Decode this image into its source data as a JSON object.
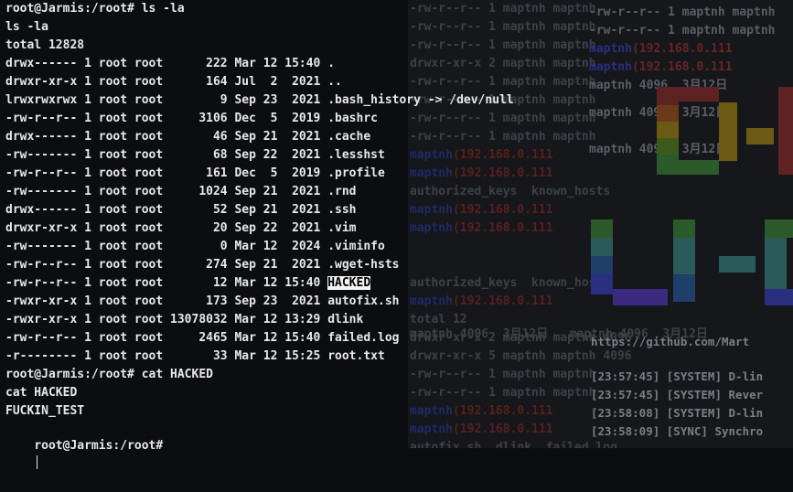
{
  "foreground_terminal": {
    "lines": [
      "root@Jarmis:/root# ls -la",
      "ls -la",
      "total 12828",
      "drwx------ 1 root root      222 Mar 12 15:40 .",
      "drwxr-xr-x 1 root root      164 Jul  2  2021 ..",
      "lrwxrwxrwx 1 root root        9 Sep 23  2021 .bash_history -> /dev/null",
      "-rw-r--r-- 1 root root     3106 Dec  5  2019 .bashrc",
      "drwx------ 1 root root       46 Sep 21  2021 .cache",
      "-rw------- 1 root root       68 Sep 22  2021 .lesshst",
      "-rw-r--r-- 1 root root      161 Dec  5  2019 .profile",
      "-rw------- 1 root root     1024 Sep 21  2021 .rnd",
      "drwx------ 1 root root       52 Sep 21  2021 .ssh",
      "drwxr-xr-x 1 root root       20 Sep 22  2021 .vim",
      "-rw------- 1 root root        0 Mar 12  2024 .viminfo",
      "-rw-r--r-- 1 root root      274 Sep 21  2021 .wget-hsts",
      "-rw-r--r-- 1 root root       12 Mar 12 15:40 ",
      "-rwxr-xr-x 1 root root      173 Sep 23  2021 autofix.sh",
      "-rwxr-xr-x 1 root root 13078032 Mar 12 13:29 dlink",
      "-rw-r--r-- 1 root root     2465 Mar 12 15:40 failed.log",
      "-r-------- 1 root root       33 Mar 12 15:25 root.txt",
      "root@Jarmis:/root# cat HACKED",
      "cat HACKED",
      "FUCKIN_TEST"
    ],
    "highlighted_file": "HACKED",
    "prompt": "root@Jarmis:/root#"
  },
  "background_terminal": {
    "col1": [
      "-rw-r--r-- 1 maptnh maptnh",
      "-rw-r--r-- 1 maptnh maptnh",
      "-rw-r--r-- 1 maptnh maptnh",
      "drwxr-xr-x 2 maptnh maptnh",
      "-rw-r--r-- 1 maptnh maptnh",
      "-rw-r--r-- 1 maptnh maptnh",
      "-rw-r--r-- 1 maptnh maptnh",
      "-rw-r--r-- 1 maptnh maptnh",
      "maptnh(192.168.0.111",
      "maptnh(192.168.0.111",
      "authorized_keys  known_hosts",
      "maptnh(192.168.0.111",
      "maptnh(192.168.0.111",
      "",
      "",
      "authorized_keys  known_hosts",
      "maptnh(192.168.0.111",
      "total 12",
      "drwxr-xr-x 2 maptnh maptnh 4096",
      "drwxr-xr-x 5 maptnh maptnh 4096",
      "-rw-r--r-- 1 maptnh maptnh",
      "-rw-r--r-- 1 maptnh maptnh",
      "maptnh(192.168.0.111",
      "maptnh(192.168.0.111",
      "autofix.sh  dlink  failed.log"
    ],
    "col2": [
      "-rw-r--r-- 1 maptnh maptnh",
      "-rw-r--r-- 1 maptnh maptnh",
      "maptnh(192.168.0.111",
      "maptnh(192.168.0.111",
      "maptnh 4096  3月12日",
      "maptnh 4096  3月12日",
      "maptnh 4096  3月12日"
    ],
    "github": "https://github.com/Mart",
    "logs": [
      "[23:57:45] [SYSTEM] D-lin",
      "[23:57:45] [SYSTEM] Rever",
      "[23:58:08] [SYSTEM] D-lin",
      "[23:58:09] [SYNC] Synchro"
    ],
    "extra": "maptnh 4096  3月12日   maptnh 4096  3月12日"
  },
  "colors": {
    "fg_text": "#e8e8e8",
    "bg": "#0c0d10",
    "highlight_bg": "#f4f4f4"
  }
}
